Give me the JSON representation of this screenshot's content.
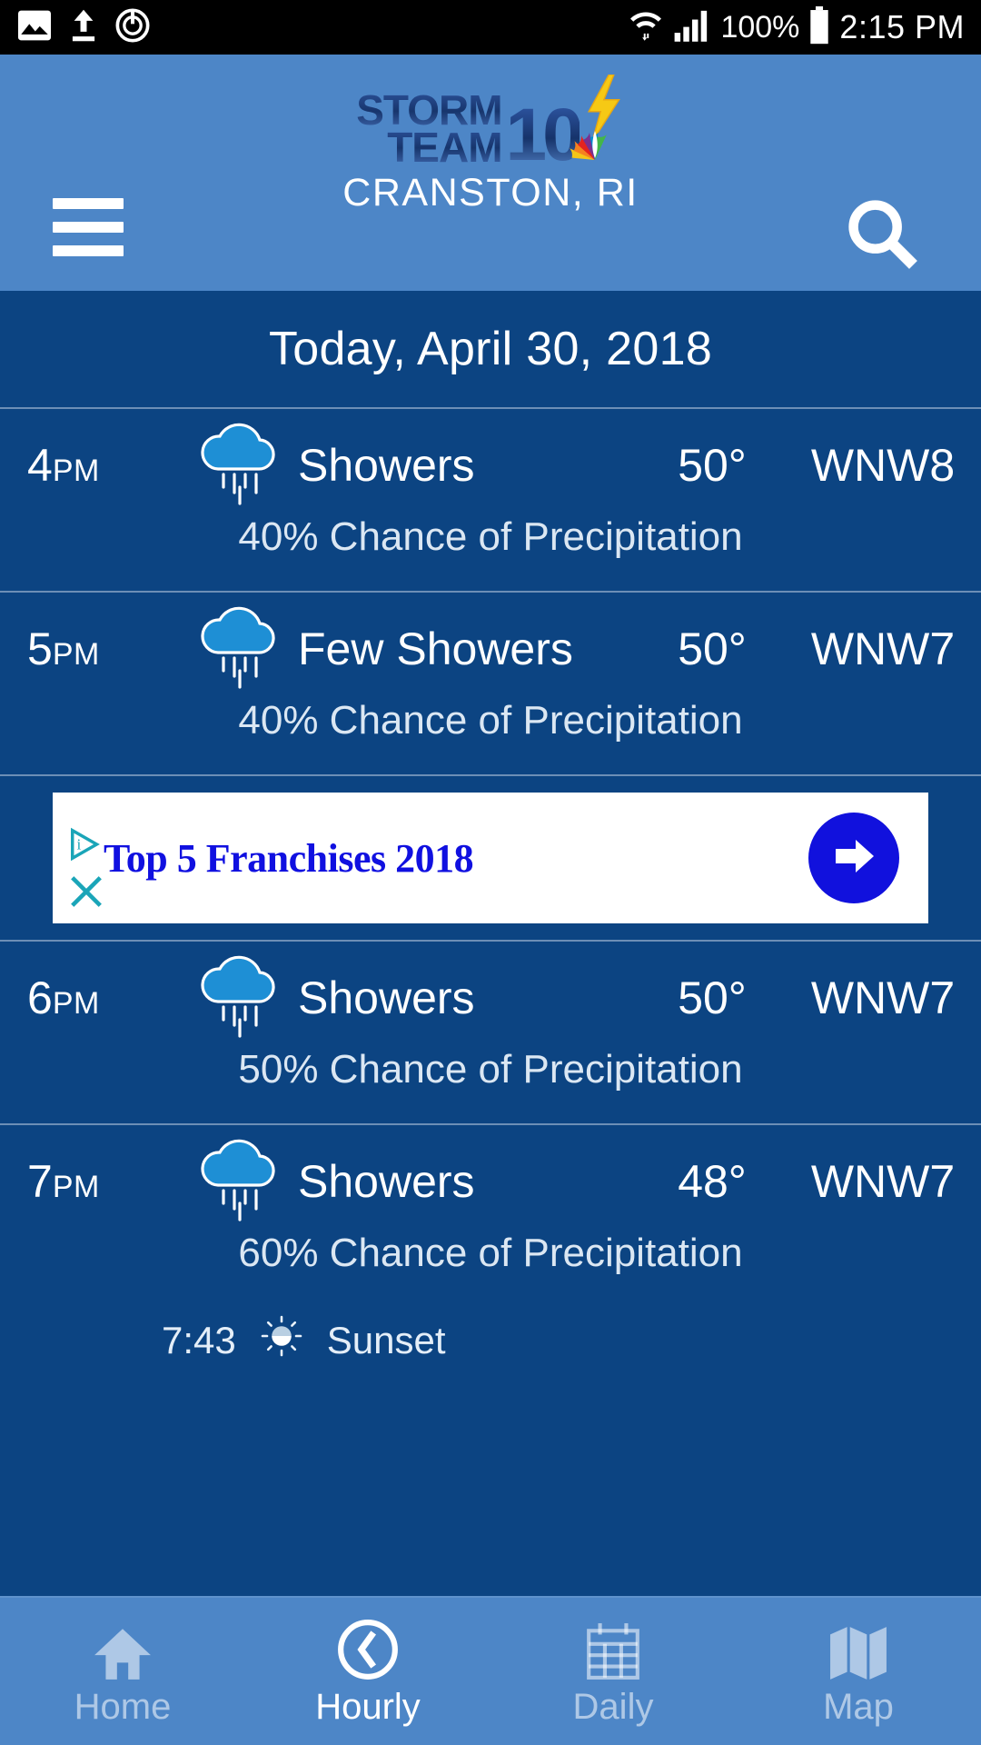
{
  "statusbar": {
    "icons_left": [
      "image-icon",
      "upload-icon",
      "power-timer-icon"
    ],
    "wifi_icon": "wifi-icon",
    "signal_icon": "cellular-signal-icon",
    "battery_percent": "100%",
    "battery_icon": "battery-full-icon",
    "time": "2:15 PM"
  },
  "header": {
    "menu_icon": "hamburger-menu-icon",
    "search_icon": "search-icon",
    "logo": {
      "line1": "STORM",
      "line2": "TEAM",
      "channel": "10",
      "bolt_icon": "lightning-bolt-icon",
      "peacock_icon": "nbc-peacock-icon"
    },
    "location": "CRANSTON, RI",
    "background_color": "#4d86c7"
  },
  "main": {
    "date_title": "Today, April 30, 2018",
    "hours": [
      {
        "time": "4",
        "ampm": "PM",
        "icon": "rain-cloud-icon",
        "condition": "Showers",
        "temperature": "50°",
        "wind": "WNW8",
        "precipitation": "40% Chance of Precipitation"
      },
      {
        "time": "5",
        "ampm": "PM",
        "icon": "rain-cloud-icon",
        "condition": "Few Showers",
        "temperature": "50°",
        "wind": "WNW7",
        "precipitation": "40% Chance of Precipitation"
      },
      {
        "time": "6",
        "ampm": "PM",
        "icon": "rain-cloud-icon",
        "condition": "Showers",
        "temperature": "50°",
        "wind": "WNW7",
        "precipitation": "50% Chance of Precipitation"
      },
      {
        "time": "7",
        "ampm": "PM",
        "icon": "rain-cloud-icon",
        "condition": "Showers",
        "temperature": "48°",
        "wind": "WNW7",
        "precipitation": "60% Chance of Precipitation"
      }
    ],
    "sunset": {
      "time": "7:43",
      "icon": "sunset-icon",
      "label": "Sunset"
    }
  },
  "ad": {
    "title": "Top 5 Franchises 2018",
    "adchoices_icon": "adchoices-icon",
    "close_icon": "close-x-icon",
    "cta_icon": "arrow-right-icon",
    "title_color": "#1010e0",
    "cta_color": "#1111dd"
  },
  "tabbar": {
    "items": [
      {
        "label": "Home",
        "icon": "home-icon",
        "active": false
      },
      {
        "label": "Hourly",
        "icon": "clock-icon",
        "active": true
      },
      {
        "label": "Daily",
        "icon": "calendar-icon",
        "active": false
      },
      {
        "label": "Map",
        "icon": "map-icon",
        "active": false
      }
    ]
  }
}
